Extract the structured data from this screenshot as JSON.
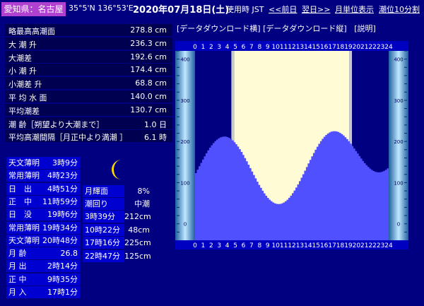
{
  "header": {
    "location": "愛知県：名古屋",
    "coords": "35°5'N 136°53'E",
    "date": "2020年07月18日(土)",
    "timezone": "使用時 JST",
    "prev_day": "<<前日",
    "next_day": "翌日>>",
    "monthly": "月単位表示",
    "ten_min": "潮位10分割"
  },
  "stats": [
    {
      "label": "略最高高潮面",
      "value": "278.8 cm"
    },
    {
      "label": "大 潮 升",
      "value": "236.3 cm"
    },
    {
      "label": "大潮差",
      "value": "192.6 cm"
    },
    {
      "label": "小 潮 升",
      "value": "174.4 cm"
    },
    {
      "label": "小潮差 升",
      "value": "68.8 cm"
    },
    {
      "label": "平 均 水 面",
      "value": "140.0 cm"
    },
    {
      "label": "平均潮差",
      "value": "130.7 cm"
    },
    {
      "label": "潮 齢［朔望より大潮まで］",
      "value": "1.0 日"
    },
    {
      "label": "平均高潮間隔［月正中より満潮 ］",
      "value": "6.1 時"
    }
  ],
  "sun": [
    {
      "label": "天文薄明",
      "value": "3時9分"
    },
    {
      "label": "常用薄明",
      "value": "4時23分"
    },
    {
      "label": "日　出",
      "value": "4時51分"
    },
    {
      "label": "正　中",
      "value": "11時59分"
    },
    {
      "label": "日　没",
      "value": "19時6分"
    },
    {
      "label": "常用薄明",
      "value": "19時34分"
    },
    {
      "label": "天文薄明",
      "value": "20時48分"
    },
    {
      "label": "月 齢",
      "value": "26.8"
    },
    {
      "label": "月 出",
      "value": "2時14分"
    },
    {
      "label": "正 中",
      "value": "9時35分"
    },
    {
      "label": "月 入",
      "value": "17時1分"
    }
  ],
  "moon": {
    "illum_label": "月輝面",
    "illum_value": "8%",
    "tide_label": "潮回り",
    "tide_value": "中潮"
  },
  "tides": [
    {
      "time": "3時39分",
      "height": "212cm"
    },
    {
      "time": "10時22分",
      "height": "48cm"
    },
    {
      "time": "17時16分",
      "height": "225cm"
    },
    {
      "time": "22時47分",
      "height": "125cm"
    }
  ],
  "downloads": {
    "horizontal": "[データダウンロード横]",
    "vertical": "[データダウンロード縦]",
    "help": "[説明]"
  },
  "chart_data": {
    "type": "area",
    "x_ticks": [
      "0",
      "1",
      "2",
      "3",
      "4",
      "5",
      "6",
      "7",
      "8",
      "9",
      "10",
      "11",
      "12",
      "13",
      "14",
      "15",
      "16",
      "17",
      "18",
      "19",
      "20",
      "21",
      "22",
      "23",
      "24"
    ],
    "y_ticks": [
      "0",
      "100",
      "200",
      "300",
      "400"
    ],
    "ylim": [
      -40,
      420
    ],
    "xlim": [
      0,
      24
    ],
    "daylight": {
      "start_hour": 4.85,
      "end_hour": 19.1
    },
    "tide_extremes": [
      {
        "hour": 3.65,
        "cm": 212
      },
      {
        "hour": 10.37,
        "cm": 48
      },
      {
        "hour": 17.27,
        "cm": 225
      },
      {
        "hour": 22.78,
        "cm": 125
      }
    ],
    "colors": {
      "tide": "#5050ff",
      "day": "#fffbd5",
      "night": "#000080"
    }
  }
}
